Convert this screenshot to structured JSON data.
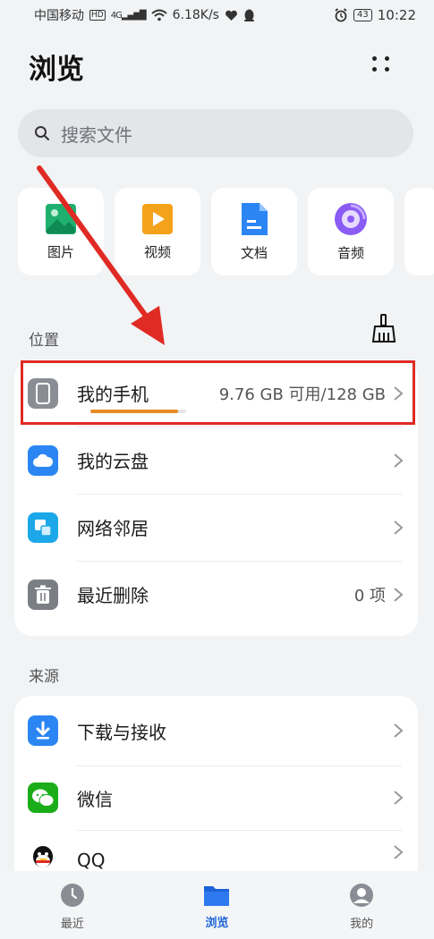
{
  "status_bar": {
    "carrier": "中国移动",
    "network_badge": "HD",
    "signal": "4G",
    "speed": "6.18K/s",
    "battery": "43",
    "time": "10:22"
  },
  "header": {
    "title": "浏览"
  },
  "search": {
    "placeholder": "搜索文件"
  },
  "categories": [
    {
      "label": "图片",
      "icon": "image-icon",
      "color": "#1fb06f"
    },
    {
      "label": "视频",
      "icon": "video-icon",
      "color": "#f5a21b"
    },
    {
      "label": "文档",
      "icon": "document-icon",
      "color": "#2b86f3"
    },
    {
      "label": "音频",
      "icon": "audio-icon",
      "color": "#8b5cf5"
    }
  ],
  "locations": {
    "section_label": "位置",
    "items": [
      {
        "label": "我的手机",
        "value": "9.76 GB 可用/128 GB",
        "icon": "phone-icon",
        "storage_used_fraction": 0.92
      },
      {
        "label": "我的云盘",
        "value": "",
        "icon": "cloud-icon"
      },
      {
        "label": "网络邻居",
        "value": "",
        "icon": "network-neighbor-icon"
      },
      {
        "label": "最近删除",
        "value": "0 项",
        "icon": "trash-icon"
      }
    ]
  },
  "sources": {
    "section_label": "来源",
    "items": [
      {
        "label": "下载与接收",
        "icon": "download-icon"
      },
      {
        "label": "微信",
        "icon": "wechat-icon"
      },
      {
        "label": "QQ",
        "icon": "qq-icon"
      }
    ]
  },
  "bottom_nav": [
    {
      "label": "最近",
      "icon": "clock-icon",
      "active": false
    },
    {
      "label": "浏览",
      "icon": "folder-icon",
      "active": true
    },
    {
      "label": "我的",
      "icon": "profile-icon",
      "active": false
    }
  ],
  "colors": {
    "accent": "#1b63d8",
    "annotation": "#e02a24",
    "progress": "#e78b25"
  }
}
